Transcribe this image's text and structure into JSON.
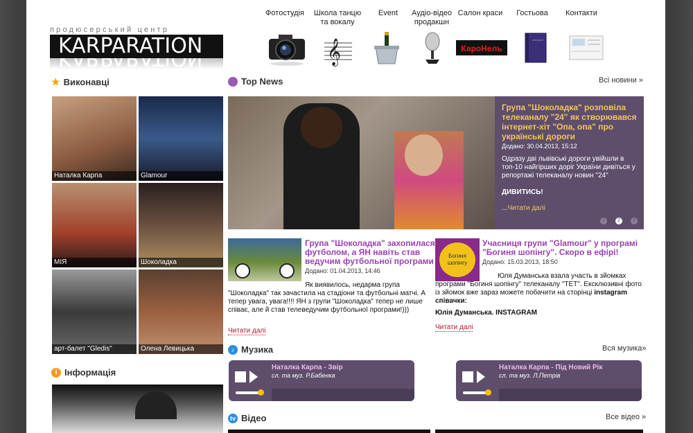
{
  "brand": {
    "subtitle": "продюсерський центр",
    "logo": "KARPARATION"
  },
  "nav": [
    {
      "label": "Фотостудія"
    },
    {
      "label": "Школа танцю та вокалу"
    },
    {
      "label": "Event"
    },
    {
      "label": "Аудіо-відео продакшн"
    },
    {
      "label": "Салон краси",
      "image_text": "КароНель"
    },
    {
      "label": "Гостьова"
    },
    {
      "label": "Контакти"
    }
  ],
  "performers": {
    "title": "Виконавці",
    "items": [
      {
        "name": "Наталка Карпа"
      },
      {
        "name": "Glamour"
      },
      {
        "name": "МІЯ"
      },
      {
        "name": "Шоколадка"
      },
      {
        "name": "арт-балет \"Gledis\""
      },
      {
        "name": "Олена Левицька"
      }
    ]
  },
  "info": {
    "title": "Інформація"
  },
  "top_news": {
    "title": "Top News",
    "all_link": "Всі новини »",
    "hero": {
      "title": "Група \"Шоколадка\" розповіла телеканалу \"24\" як створювався інтернет-хіт \"Опа, опа\" про українські дороги",
      "date": "Додано: 30.04.2013, 15:12",
      "text": "Одразу дві львівські дороги увійшли в топ-10 найгірших доріг України дивіться у репортажі телеканалу новин \"24\"",
      "bold": "ДИВИТИСЬ!",
      "more_prefix": "...",
      "more": "Читати далі",
      "pages": [
        "1",
        "2",
        "3"
      ]
    },
    "items": [
      {
        "title": "Група \"Шоколадка\" захопилася футболом, а ЯН навіть став ведучим футбольної програми",
        "date": "Додано: 01.04.2013, 14:46",
        "text": "Як виявилось, недарма група \"Шоколадка\" так зачастила на стадіони та футбольні матчі. А тепер увага, увага!!!! ЯН з групи \"Шоколадка\" тепер не лише співає, але й став телеведучим футбольної програми!)))",
        "more": "Читати далі"
      },
      {
        "title": "Учасниця групи \"Glamour\" у програмі \"Богиня шопінгу\". Скоро в ефірі!",
        "date": "Додано: 15.03.2013, 18:50",
        "text": "Юля Думанська взала участь в зйомках програми \"Богиня шопінгу\" телеканалу \"ТЕТ\". Ексклюзивні фото із зйомок вже зараз можете побачити на сторінці",
        "text_bold": "instagram співачки:",
        "bold_line": "Юлія Думанська. INSTAGRAM",
        "image_text": "Богиня шопінгу",
        "more": "Читати далі"
      }
    ]
  },
  "music": {
    "title": "Музика",
    "all_link": "Вся музика»",
    "tracks": [
      {
        "title": "Наталка Карпа - Звір",
        "authors": "сл. та муз. Р.Бабенка"
      },
      {
        "title": "Наталка Карпа - Під Новий Рік",
        "authors": "сл. та муз. Л.Петрів"
      }
    ]
  },
  "video": {
    "title": "Відео",
    "all_link": "Все відео »",
    "icon_text": "tv"
  },
  "colors": {
    "accent": "#9b3fb3",
    "panel": "#5e4e6c",
    "link_red": "#c0102a",
    "hero_title": "#f3c45a"
  }
}
